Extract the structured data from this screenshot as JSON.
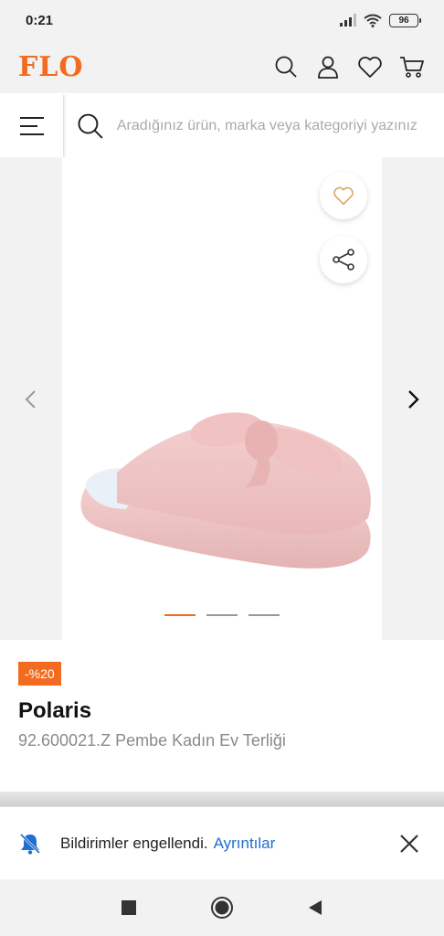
{
  "status_bar": {
    "time": "0:21",
    "battery": "96"
  },
  "header": {
    "logo": "FLO",
    "icons": [
      "search-icon",
      "user-icon",
      "heart-icon",
      "cart-icon"
    ]
  },
  "search": {
    "placeholder": "Aradığınız ürün, marka veya kategoriyi yazınız"
  },
  "gallery": {
    "image_count": 3,
    "active_index": 0,
    "buttons": [
      "heart-icon",
      "share-icon"
    ]
  },
  "product": {
    "discount_badge": "-%20",
    "brand": "Polaris",
    "name": "92.600021.Z Pembe Kadın Ev Terliği"
  },
  "notification": {
    "text": "Bildirimler engellendi.",
    "link": "Ayrıntılar"
  },
  "colors": {
    "accent": "#f26b20",
    "link": "#1f6fd1"
  }
}
